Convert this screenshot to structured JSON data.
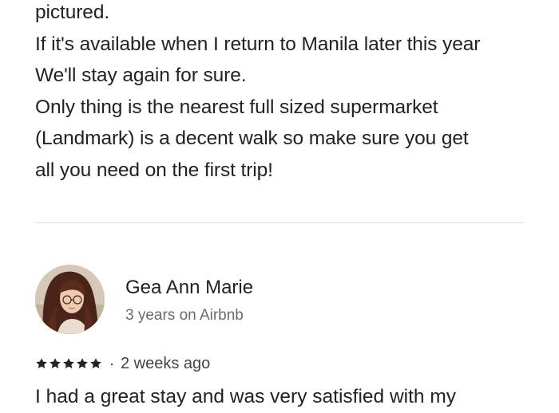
{
  "previous_review": {
    "lines": [
      "pictured.",
      "If it's available when I return to Manila later this year",
      "We'll stay again for sure.",
      "Only thing is the nearest full sized supermarket",
      "(Landmark) is a decent walk so make sure you get",
      "all you need on the first trip!"
    ]
  },
  "review": {
    "reviewer_name": "Gea Ann Marie",
    "reviewer_tenure": "3 years on Airbnb",
    "rating": 5,
    "separator": "·",
    "date": "2 weeks ago",
    "text_start": "I had a great stay and was very satisfied with my"
  },
  "colors": {
    "text": "#222222",
    "secondary_text": "#6a6a6a",
    "divider": "#dddddd"
  },
  "icons": {
    "star": "star-icon"
  }
}
